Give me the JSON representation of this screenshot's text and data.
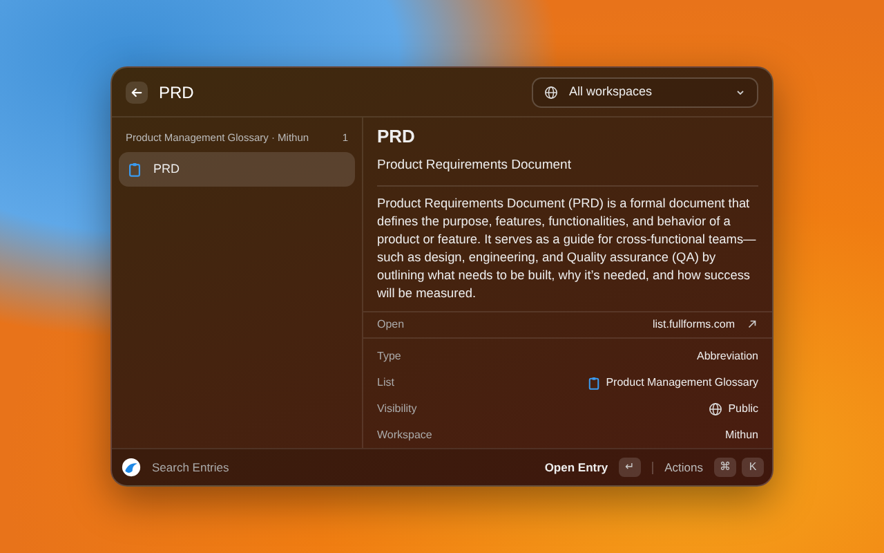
{
  "header": {
    "query": "PRD",
    "workspace_select": "All workspaces"
  },
  "sidebar": {
    "group": {
      "title": "Product Management Glossary · Mithun",
      "count": "1"
    },
    "items": [
      {
        "label": "PRD",
        "selected": true
      }
    ]
  },
  "detail": {
    "title": "PRD",
    "subtitle": "Product Requirements Document",
    "description": "Product Requirements Document (PRD) is a formal document that defines the purpose, features, functionalities, and behavior of a product or feature. It serves as a guide for cross-functional teams—such as design, engineering, and Quality assurance (QA) by outlining what needs to be built, why it’s needed, and how success will be measured.",
    "open": {
      "label": "Open",
      "value": "list.fullforms.com"
    },
    "properties": [
      {
        "kind": "plain",
        "label": "Type",
        "value": "Abbreviation"
      },
      {
        "kind": "list",
        "label": "List",
        "value": "Product Management Glossary"
      },
      {
        "kind": "visibility",
        "label": "Visibility",
        "value": "Public"
      },
      {
        "kind": "plain",
        "label": "Workspace",
        "value": "Mithun"
      }
    ]
  },
  "footer": {
    "search": "Search Entries",
    "primary_action": "Open Entry",
    "primary_key": "↵",
    "actions": "Actions",
    "action_keys": [
      "⌘",
      "K"
    ]
  }
}
